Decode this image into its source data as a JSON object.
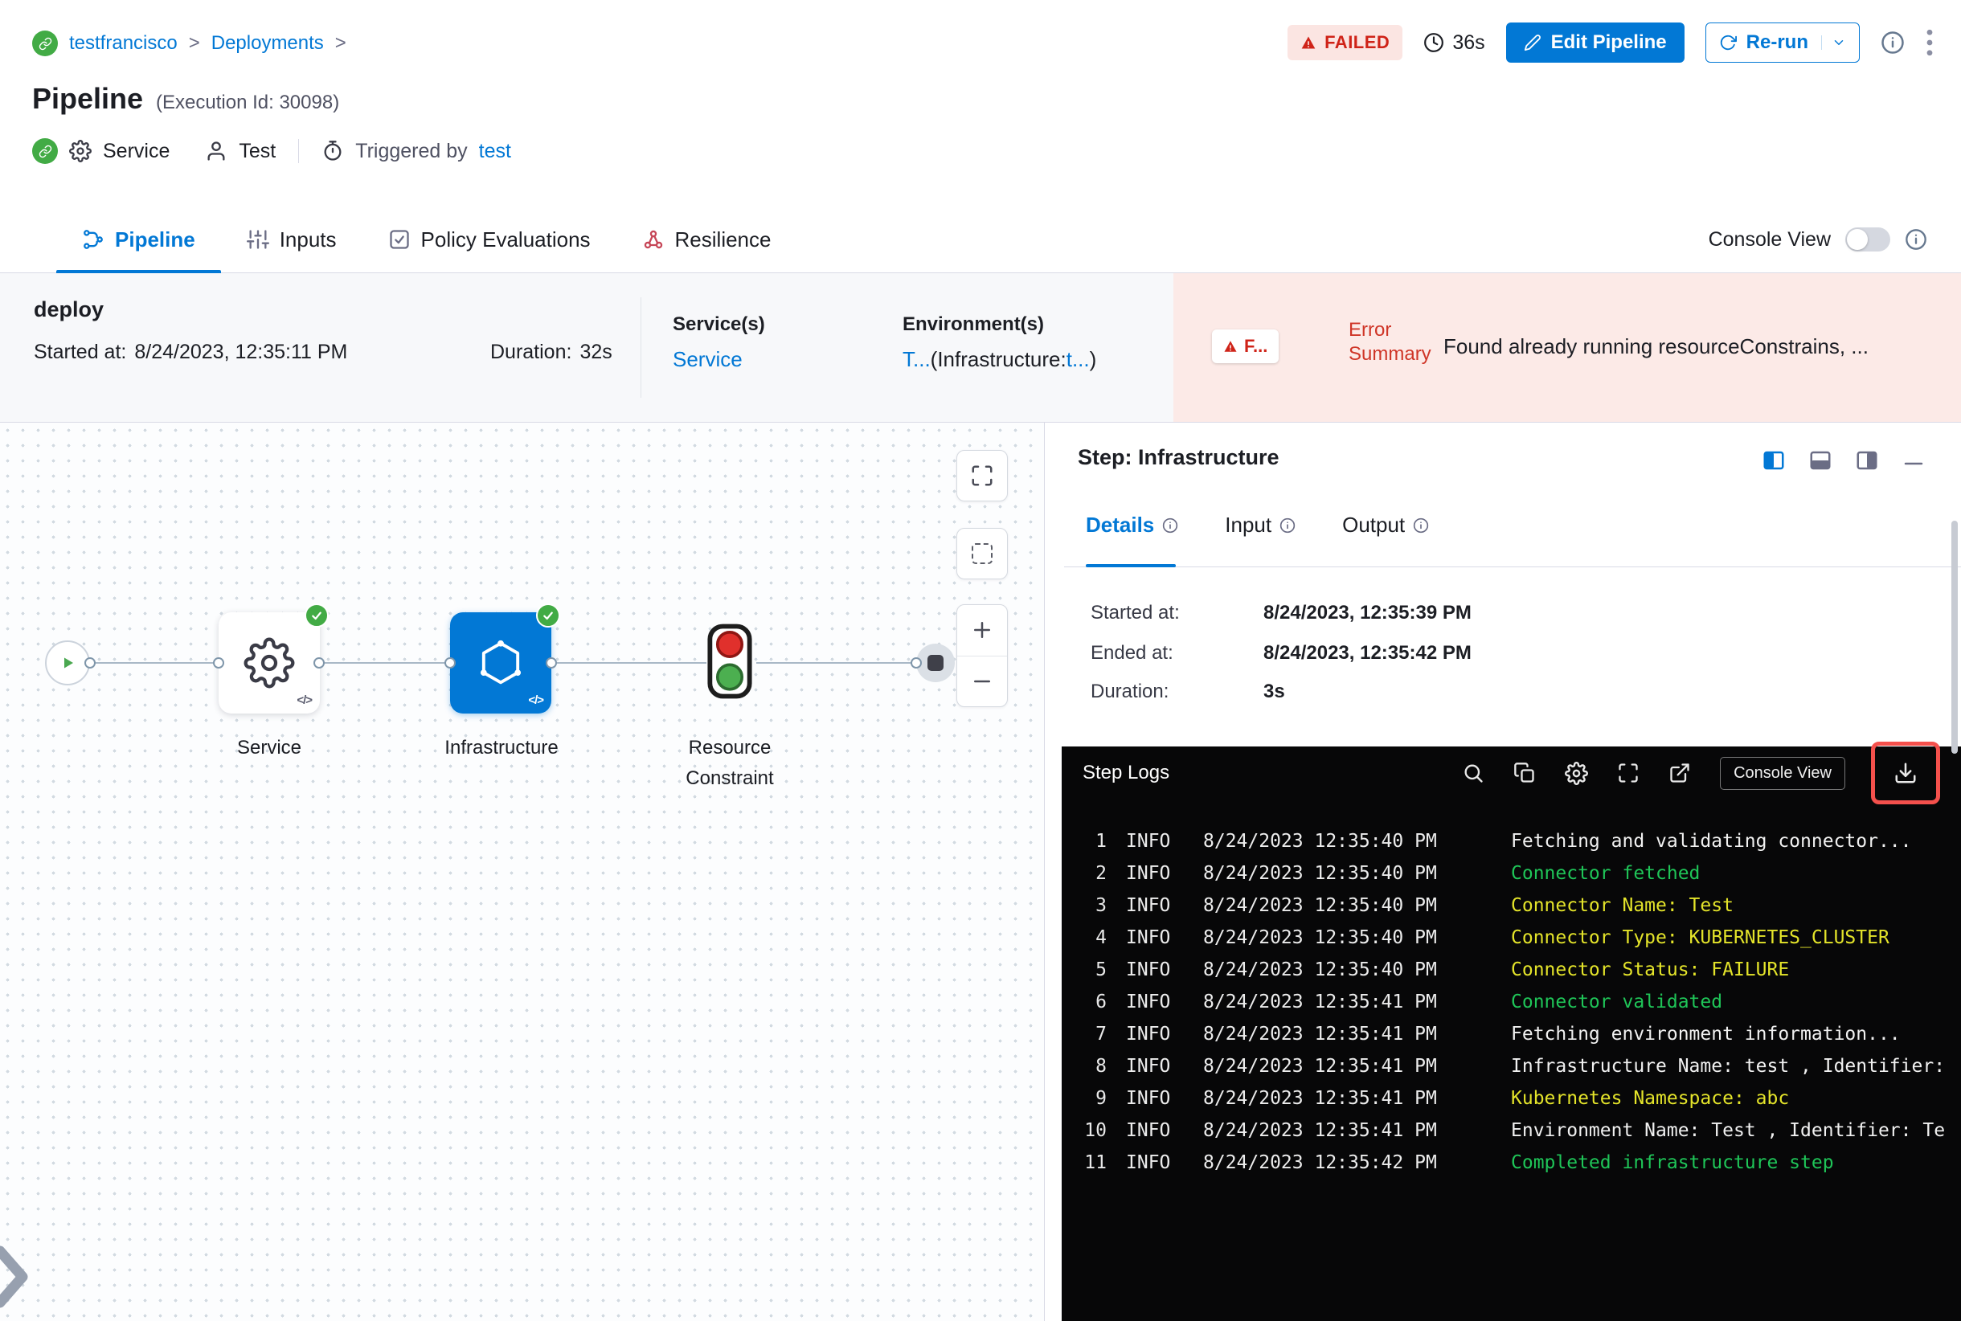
{
  "header": {
    "breadcrumb": {
      "project": "testfrancisco",
      "section": "Deployments",
      "separator": ">"
    },
    "title": "Pipeline",
    "execution_id": "(Execution Id: 30098)",
    "meta": {
      "service": "Service",
      "user": "Test",
      "triggered_by_label": "Triggered by",
      "triggered_by_value": "test"
    },
    "status_badge": "FAILED",
    "elapsed": "36s",
    "edit_button": "Edit Pipeline",
    "rerun_button": "Re-run"
  },
  "tabbar": {
    "tabs": [
      "Pipeline",
      "Inputs",
      "Policy Evaluations",
      "Resilience"
    ],
    "console_view_label": "Console View"
  },
  "summary": {
    "stage_name": "deploy",
    "started_label": "Started at:",
    "started_value": "8/24/2023, 12:35:11 PM",
    "duration_label": "Duration:",
    "duration_value": "32s",
    "services_label": "Service(s)",
    "services_value": "Service",
    "environments_label": "Environment(s)",
    "environments_link": "T...",
    "environments_paren_prefix": "(Infrastructure:",
    "environments_paren_link": "t...",
    "environments_paren_suffix": ")",
    "error_badge": "F...",
    "error_summary_label": "Error Summary",
    "error_message": "Found already running resourceConstrains, ..."
  },
  "graph": {
    "code_glyph": "</>",
    "nodes": {
      "service": "Service",
      "infrastructure": "Infrastructure",
      "resource_line1": "Resource",
      "resource_line2": "Constraint"
    }
  },
  "step_panel": {
    "title": "Step: Infrastructure",
    "tabs": [
      "Details",
      "Input",
      "Output"
    ],
    "details": {
      "started_label": "Started at:",
      "started_value": "8/24/2023, 12:35:39 PM",
      "ended_label": "Ended at:",
      "ended_value": "8/24/2023, 12:35:42 PM",
      "duration_label": "Duration:",
      "duration_value": "3s"
    }
  },
  "logs": {
    "title": "Step Logs",
    "console_view_button": "Console View",
    "lines": [
      {
        "num": "1",
        "level": "INFO",
        "time": "8/24/2023 12:35:40 PM",
        "message": "Fetching and validating connector...",
        "color": "white"
      },
      {
        "num": "2",
        "level": "INFO",
        "time": "8/24/2023 12:35:40 PM",
        "message": "Connector fetched",
        "color": "green"
      },
      {
        "num": "3",
        "level": "INFO",
        "time": "8/24/2023 12:35:40 PM",
        "message": "Connector Name: Test",
        "color": "yellow"
      },
      {
        "num": "4",
        "level": "INFO",
        "time": "8/24/2023 12:35:40 PM",
        "message": "Connector Type: KUBERNETES_CLUSTER",
        "color": "yellow"
      },
      {
        "num": "5",
        "level": "INFO",
        "time": "8/24/2023 12:35:40 PM",
        "message": "Connector Status: FAILURE",
        "color": "yellow"
      },
      {
        "num": "6",
        "level": "INFO",
        "time": "8/24/2023 12:35:41 PM",
        "message": "Connector validated",
        "color": "green"
      },
      {
        "num": "7",
        "level": "INFO",
        "time": "8/24/2023 12:35:41 PM",
        "message": "Fetching environment information...",
        "color": "white"
      },
      {
        "num": "8",
        "level": "INFO",
        "time": "8/24/2023 12:35:41 PM",
        "message": "Infrastructure Name: test , Identifier:",
        "color": "white"
      },
      {
        "num": "9",
        "level": "INFO",
        "time": "8/24/2023 12:35:41 PM",
        "message": "Kubernetes Namespace: abc",
        "color": "yellow"
      },
      {
        "num": "10",
        "level": "INFO",
        "time": "8/24/2023 12:35:41 PM",
        "message": "Environment Name: Test , Identifier: Te",
        "color": "white"
      },
      {
        "num": "11",
        "level": "INFO",
        "time": "8/24/2023 12:35:42 PM",
        "message": "Completed infrastructure step",
        "color": "green"
      }
    ]
  }
}
